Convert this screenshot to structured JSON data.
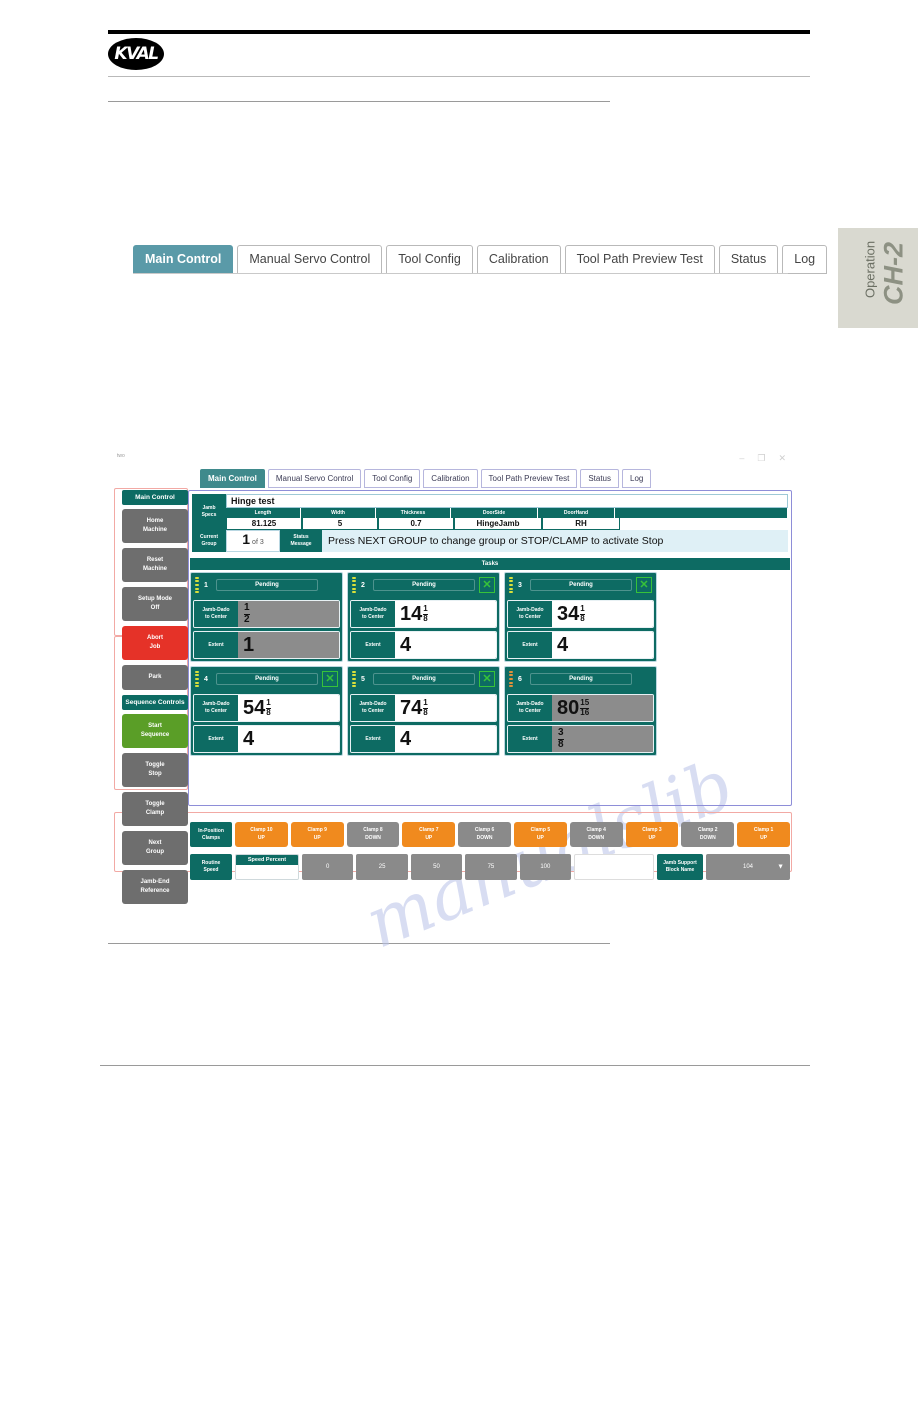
{
  "manual": {
    "brand": "KVAL",
    "chapter_label": "Operation",
    "chapter_number": "CH-2"
  },
  "doc_tabs": [
    {
      "label": "Main Control",
      "active": true
    },
    {
      "label": "Manual Servo Control",
      "active": false
    },
    {
      "label": "Tool Config",
      "active": false
    },
    {
      "label": "Calibration",
      "active": false
    },
    {
      "label": "Tool Path Preview Test",
      "active": false
    },
    {
      "label": "Status",
      "active": false
    },
    {
      "label": "Log",
      "active": false
    }
  ],
  "screenshot": {
    "window": {
      "title": "two",
      "minimize": "–",
      "restore": "❐",
      "close": "✕"
    },
    "tabs": [
      {
        "label": "Main Control",
        "active": true
      },
      {
        "label": "Manual Servo Control",
        "active": false
      },
      {
        "label": "Tool Config",
        "active": false
      },
      {
        "label": "Calibration",
        "active": false
      },
      {
        "label": "Tool Path Preview Test",
        "active": false
      },
      {
        "label": "Status",
        "active": false
      },
      {
        "label": "Log",
        "active": false
      }
    ],
    "sidebar": {
      "group1_title": "Main Control",
      "group1_buttons": [
        {
          "label": "Home\nMachine",
          "style": "grey"
        },
        {
          "label": "Reset\nMachine",
          "style": "grey"
        },
        {
          "label": "Setup Mode\nOff",
          "style": "grey"
        },
        {
          "label": "Abort\nJob",
          "style": "red"
        },
        {
          "label": "Park",
          "style": "grey"
        }
      ],
      "group2_title": "Sequence Controls",
      "group2_buttons": [
        {
          "label": "Start\nSequence",
          "style": "green"
        },
        {
          "label": "Toggle\nStop",
          "style": "grey"
        },
        {
          "label": "Toggle\nClamp",
          "style": "grey"
        },
        {
          "label": "Next\nGroup",
          "style": "grey"
        },
        {
          "label": "Jamb-End\nReference",
          "style": "grey"
        }
      ]
    },
    "specs": {
      "panel_label": "Jamb\nSpecs",
      "job_name": "Hinge test",
      "columns": [
        "Length",
        "Width",
        "Thickness",
        "DoorSide",
        "DoorHand"
      ],
      "values": [
        "81.125",
        "5",
        "0.7",
        "HingeJamb",
        "RH"
      ]
    },
    "current_group": {
      "label": "Current\nGroup",
      "value": "1",
      "of": "of 3",
      "status_label": "Status\nMessage",
      "status_message": "Press NEXT GROUP to change group or STOP/CLAMP to activate Stop"
    },
    "tasks_header": "Tasks",
    "tasks": [
      {
        "index": "1",
        "state": "Pending",
        "checked": false,
        "grip": "yellow",
        "enabled": false,
        "dado_label": "Jamb-Dado\nto Center",
        "dado_whole": "",
        "dado_num": "1",
        "dado_den": "2",
        "extent_label": "Extent",
        "extent_whole": "1",
        "extent_num": "",
        "extent_den": ""
      },
      {
        "index": "2",
        "state": "Pending",
        "checked": true,
        "grip": "yellow",
        "enabled": true,
        "dado_label": "Jamb-Dado\nto Center",
        "dado_whole": "14",
        "dado_num": "1",
        "dado_den": "8",
        "extent_label": "Extent",
        "extent_whole": "4",
        "extent_num": "",
        "extent_den": ""
      },
      {
        "index": "3",
        "state": "Pending",
        "checked": true,
        "grip": "yellow",
        "enabled": true,
        "dado_label": "Jamb-Dado\nto Center",
        "dado_whole": "34",
        "dado_num": "1",
        "dado_den": "8",
        "extent_label": "Extent",
        "extent_whole": "4",
        "extent_num": "",
        "extent_den": ""
      },
      {
        "index": "4",
        "state": "Pending",
        "checked": true,
        "grip": "yellow",
        "enabled": true,
        "dado_label": "Jamb-Dado\nto Center",
        "dado_whole": "54",
        "dado_num": "1",
        "dado_den": "8",
        "extent_label": "Extent",
        "extent_whole": "4",
        "extent_num": "",
        "extent_den": ""
      },
      {
        "index": "5",
        "state": "Pending",
        "checked": true,
        "grip": "yellow",
        "enabled": true,
        "dado_label": "Jamb-Dado\nto Center",
        "dado_whole": "74",
        "dado_num": "1",
        "dado_den": "8",
        "extent_label": "Extent",
        "extent_whole": "4",
        "extent_num": "",
        "extent_den": ""
      },
      {
        "index": "6",
        "state": "Pending",
        "checked": false,
        "grip": "orange",
        "enabled": false,
        "dado_label": "Jamb-Dado\nto Center",
        "dado_whole": "80",
        "dado_num": "15",
        "dado_den": "16",
        "extent_label": "Extent",
        "extent_whole": "",
        "extent_num": "3",
        "extent_den": "8"
      }
    ],
    "clamps": {
      "label": "In-Position\nClamps",
      "items": [
        {
          "name": "Clamp 10",
          "state": "UP"
        },
        {
          "name": "Clamp 9",
          "state": "UP"
        },
        {
          "name": "Clamp 8",
          "state": "DOWN"
        },
        {
          "name": "Clamp 7",
          "state": "UP"
        },
        {
          "name": "Clamp 6",
          "state": "DOWN"
        },
        {
          "name": "Clamp 5",
          "state": "UP"
        },
        {
          "name": "Clamp 4",
          "state": "DOWN"
        },
        {
          "name": "Clamp 3",
          "state": "UP"
        },
        {
          "name": "Clamp 2",
          "state": "DOWN"
        },
        {
          "name": "Clamp 1",
          "state": "UP"
        }
      ]
    },
    "speed": {
      "label": "Routine\nSpeed",
      "percent_caption": "Speed Percent",
      "percent_value": "",
      "presets": [
        "0",
        "25",
        "50",
        "75",
        "100"
      ],
      "block_label": "Jamb Support\nBlock Name",
      "block_value": "104",
      "caret": "▼"
    }
  },
  "colors": {
    "teal": "#0d6b63",
    "tab_active": "#5a9aa8",
    "orange": "#f08a1e",
    "grey": "#8a8a8a",
    "red": "#e53228",
    "green": "#5a9e27",
    "check_green": "#37c23a",
    "annotation_pink": "#f2a9a4",
    "annotation_blue": "#8e8ed8"
  }
}
